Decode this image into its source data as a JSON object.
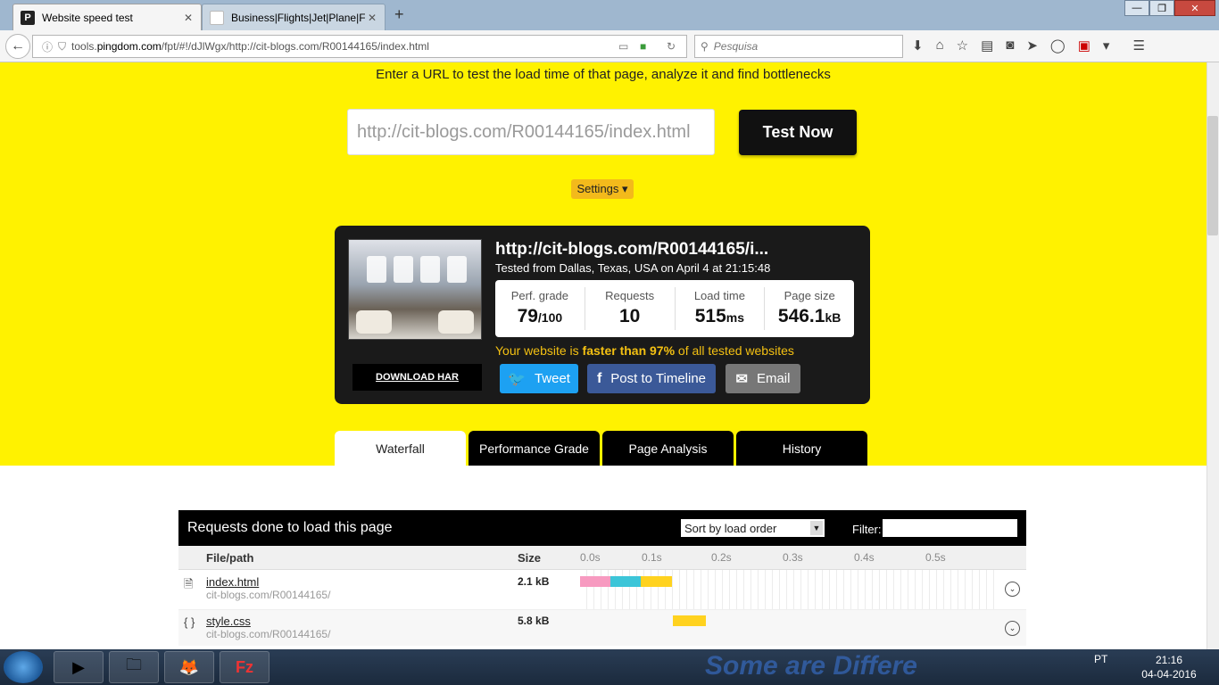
{
  "browser": {
    "tabs": [
      {
        "label": "Website speed test",
        "active": true
      },
      {
        "label": "Business|Flights|Jet|Plane|F...",
        "active": false
      }
    ],
    "url": {
      "prefix": "tools.",
      "host": "pingdom.com",
      "suffix": "/fpt/#!/dJlWgx/http://cit-blogs.com/R00144165/index.html"
    },
    "search_placeholder": "Pesquisa"
  },
  "hero": {
    "tagline": "Enter a URL to test the load time of that page, analyze it and find bottlenecks",
    "input_value": "http://cit-blogs.com/R00144165/index.html",
    "test_button": "Test Now",
    "settings_label": "Settings ▾"
  },
  "result": {
    "url": "http://cit-blogs.com/R00144165/i...",
    "tested": "Tested from Dallas, Texas, USA on April 4 at 21:15:48",
    "stats": [
      {
        "label": "Perf. grade",
        "value": "79",
        "unit": "/100"
      },
      {
        "label": "Requests",
        "value": "10",
        "unit": ""
      },
      {
        "label": "Load time",
        "value": "515",
        "unit": "ms"
      },
      {
        "label": "Page size",
        "value": "546.1",
        "unit": "kB"
      }
    ],
    "faster": {
      "pre": "Your website is ",
      "bold": "faster than 97%",
      "post": " of all tested websites"
    },
    "download_har": "DOWNLOAD HAR",
    "share": {
      "tweet": "Tweet",
      "facebook": "Post to Timeline",
      "email": "Email"
    }
  },
  "page_tabs": [
    "Waterfall",
    "Performance Grade",
    "Page Analysis",
    "History"
  ],
  "requests": {
    "title": "Requests done to load this page",
    "sort_value": "Sort by load order",
    "filter_label": "Filter:",
    "columns": {
      "file": "File/path",
      "size": "Size"
    },
    "ticks": [
      "0.0s",
      "0.1s",
      "0.2s",
      "0.3s",
      "0.4s",
      "0.5s"
    ],
    "rows": [
      {
        "icon": "html-file-icon",
        "name": "index.html",
        "path": "cit-blogs.com/R00144165/",
        "size": "2.1 kB",
        "timing_s": [
          {
            "phase": "dns",
            "start": 0.0,
            "end": 0.043,
            "color": "#f79ac0"
          },
          {
            "phase": "connect",
            "start": 0.043,
            "end": 0.086,
            "color": "#3cc5d8"
          },
          {
            "phase": "wait",
            "start": 0.086,
            "end": 0.13,
            "color": "#ffd21f"
          }
        ]
      },
      {
        "icon": "css-braces-icon",
        "name": "style.css",
        "path": "cit-blogs.com/R00144165/",
        "size": "5.8 kB",
        "timing_s": [
          {
            "phase": "wait",
            "start": 0.132,
            "end": 0.178,
            "color": "#ffd21f"
          }
        ]
      }
    ]
  },
  "taskbar": {
    "lang": "PT",
    "time": "21:16",
    "date": "04-04-2016"
  },
  "colors": {
    "hero_yellow": "#fff200",
    "dark_panel": "#1a1a1a",
    "tweet": "#1da1f2",
    "facebook": "#3b5998"
  }
}
